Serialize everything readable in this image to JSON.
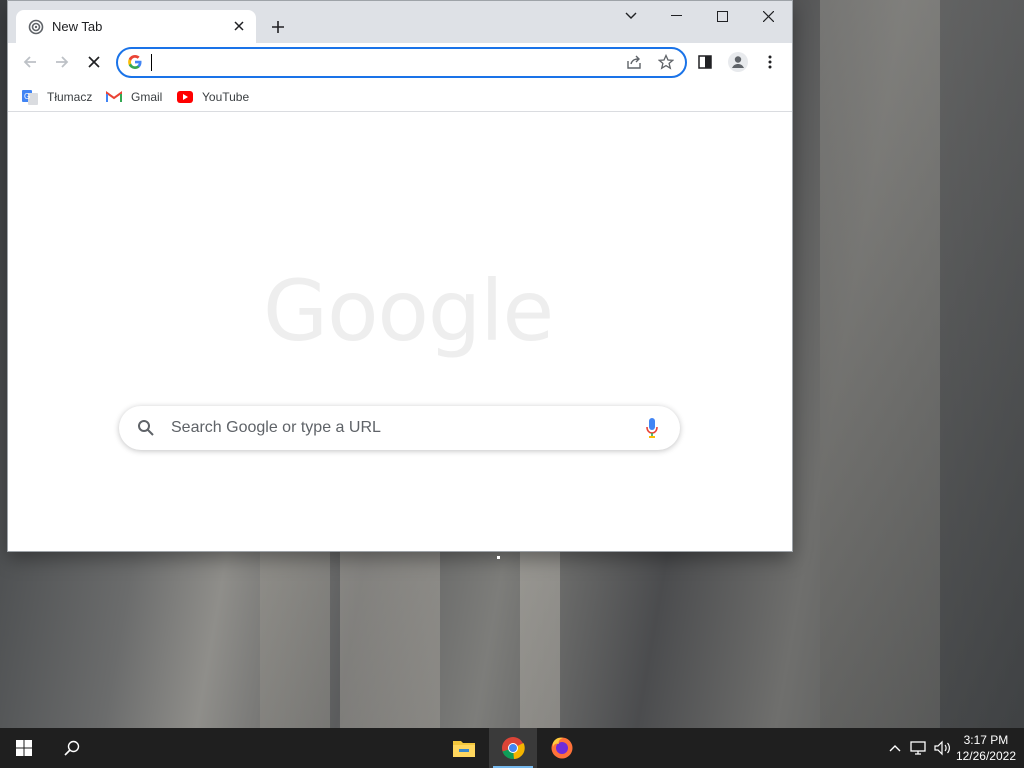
{
  "browser": {
    "tab": {
      "title": "New Tab"
    },
    "omnibox": {
      "value": "",
      "placeholder": ""
    },
    "bookmarks": [
      {
        "label": "Tłumacz",
        "icon": "google-translate-icon"
      },
      {
        "label": "Gmail",
        "icon": "gmail-icon"
      },
      {
        "label": "YouTube",
        "icon": "youtube-icon"
      }
    ],
    "new_tab_page": {
      "logo_text": "Google",
      "search_placeholder": "Search Google or type a URL"
    }
  },
  "taskbar": {
    "pinned": [
      {
        "name": "File Explorer",
        "icon": "file-explorer-icon",
        "active": false
      },
      {
        "name": "Google Chrome",
        "icon": "chrome-icon",
        "active": true
      },
      {
        "name": "Firefox",
        "icon": "firefox-icon",
        "active": false
      }
    ],
    "clock": {
      "time": "3:17 PM",
      "date": "12/26/2022"
    }
  },
  "colors": {
    "accent": "#1a73e8",
    "titlebar": "#dee1e6",
    "taskbar": "#1f1f1f"
  }
}
